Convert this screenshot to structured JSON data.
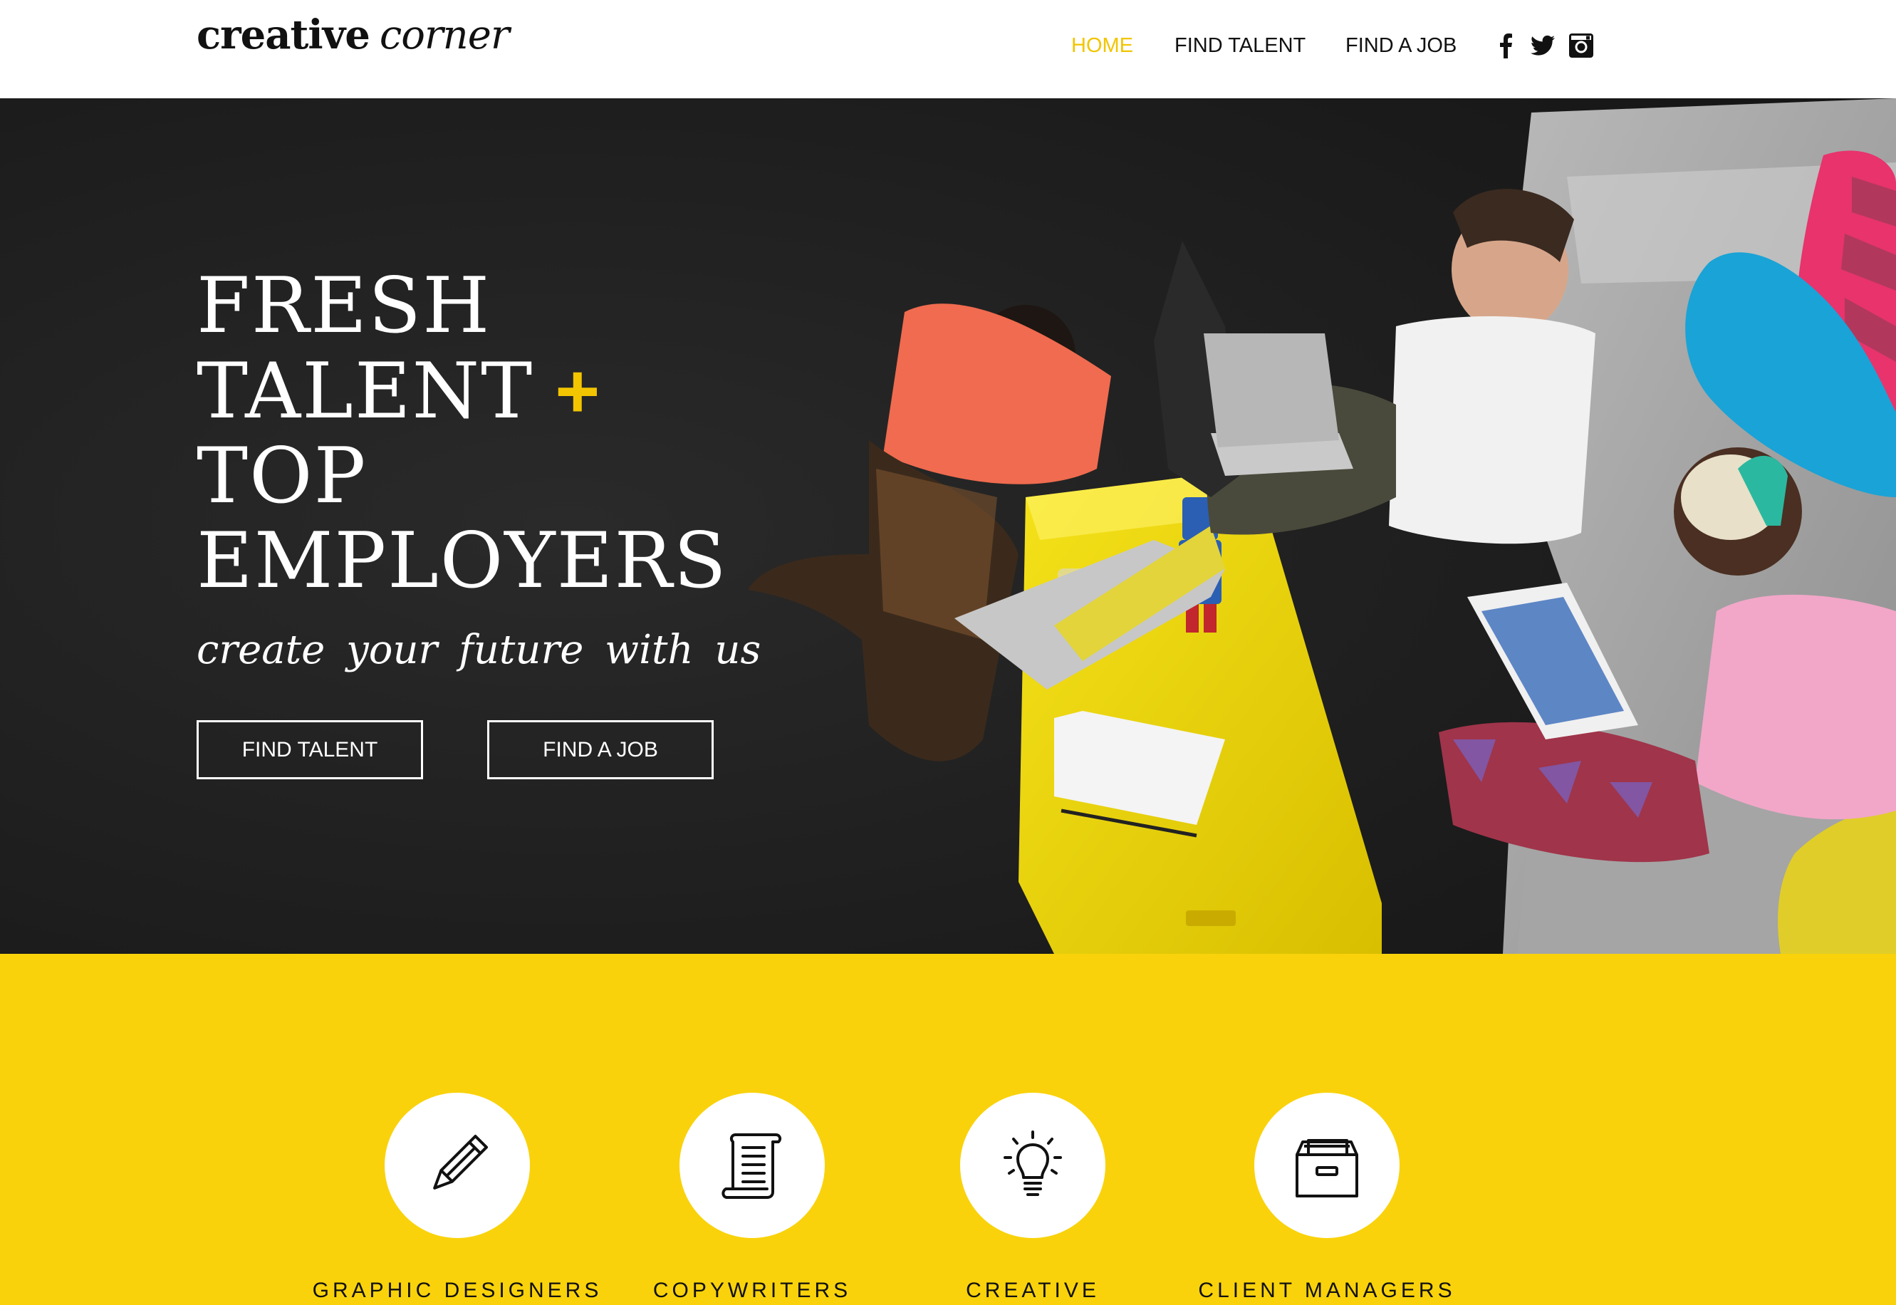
{
  "brand": {
    "logo_bold": "creative",
    "logo_italic": "corner"
  },
  "nav": {
    "items": [
      "HOME",
      "FIND TALENT",
      "FIND A JOB"
    ],
    "active": "HOME"
  },
  "social": {
    "icons": [
      "facebook-icon",
      "twitter-icon",
      "instagram-icon"
    ]
  },
  "hero": {
    "headline_line1": "FRESH",
    "headline_line2": "TALENT",
    "headline_plus": "+",
    "headline_line3": "TOP",
    "headline_line4": "EMPLOYERS",
    "tagline": "create your future with us",
    "buttons": [
      "FIND TALENT",
      "FIND A JOB"
    ]
  },
  "categories": [
    {
      "label": "GRAPHIC DESIGNERS",
      "icon": "pencil-icon"
    },
    {
      "label": "COPYWRITERS",
      "icon": "scroll-icon"
    },
    {
      "label": "CREATIVE DIRECTORS",
      "icon": "lightbulb-icon"
    },
    {
      "label": "CLIENT MANAGERS",
      "icon": "filebox-icon"
    }
  ],
  "colors": {
    "accent_yellow": "#f9d20b",
    "nav_active": "#f2c500",
    "hero_dark": "#1b1b1b",
    "text_dark": "#111111"
  }
}
